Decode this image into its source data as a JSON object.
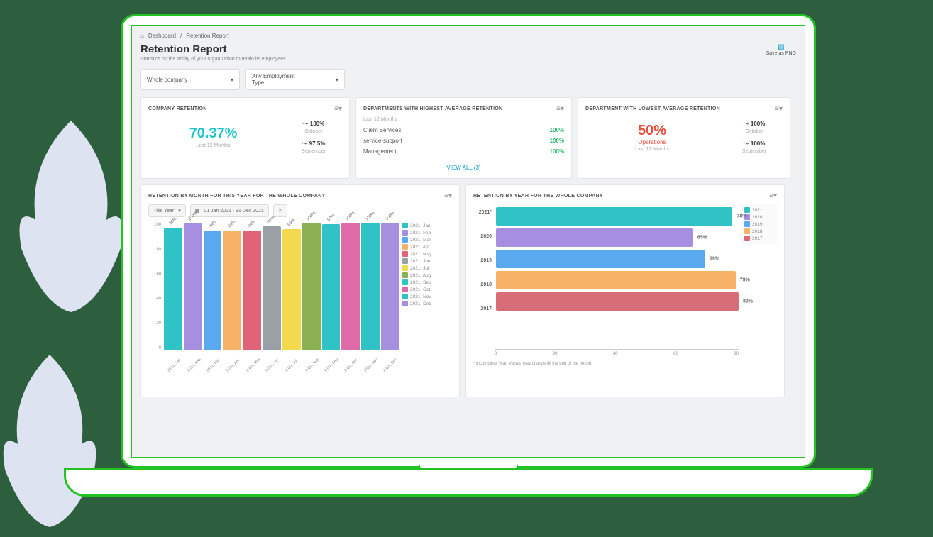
{
  "breadcrumb": {
    "home": "Dashboard",
    "current": "Retention Report"
  },
  "page": {
    "title": "Retention Report",
    "subtitle": "Statistics on the ability of your organization to retain its employees.",
    "save": "Save as PNG"
  },
  "filters": {
    "scope": "Whole company",
    "emp_type": "Any Employment Type"
  },
  "card_retention": {
    "title": "COMPANY RETENTION",
    "value": "70.37%",
    "period": "Last 12 Months",
    "m1": {
      "val": "100%",
      "lbl": "October"
    },
    "m2": {
      "val": "97.5%",
      "lbl": "September"
    }
  },
  "card_highest": {
    "title": "DEPARTMENTS WITH HIGHEST AVERAGE RETENTION",
    "period": "Last 12 Months",
    "rows": [
      {
        "name": "Client Services",
        "val": "100%"
      },
      {
        "name": "service-support",
        "val": "100%"
      },
      {
        "name": "Management",
        "val": "100%"
      }
    ],
    "view_all": "VIEW ALL (3)"
  },
  "card_lowest": {
    "title": "DEPARTMENT WITH LOWEST AVERAGE RETENTION",
    "value": "50%",
    "dept": "Operations",
    "period": "Last 12 Months",
    "m1": {
      "val": "100%",
      "lbl": "October"
    },
    "m2": {
      "val": "100%",
      "lbl": "September"
    }
  },
  "card_month": {
    "title": "RETENTION BY MONTH FOR THIS YEAR FOR THE WHOLE COMPANY",
    "range_select": "This Year",
    "date_range": "01 Jan 2021 - 31 Dec 2021"
  },
  "card_year": {
    "title": "RETENTION BY YEAR FOR THE WHOLE COMPANY",
    "note": "* Incomplete Year. Values may change till the end of the period."
  },
  "chart_data": [
    {
      "type": "bar",
      "title": "Retention by Month",
      "categories": [
        "2021, Jan",
        "2021, Feb",
        "2021, Mar",
        "2021, Apr",
        "2021, May",
        "2021, Jun",
        "2021, Jul",
        "2021, Aug",
        "2021, Sep",
        "2021, Oct",
        "2021, Nov",
        "2021, Dec"
      ],
      "values": [
        96,
        100,
        94,
        94,
        94,
        97,
        95,
        100,
        99,
        100,
        100,
        100
      ],
      "colors": [
        "#2fc3c8",
        "#a68fe0",
        "#5aa8ed",
        "#f7b267",
        "#e06377",
        "#9aa0a6",
        "#f2d94e",
        "#8bb153",
        "#2fc3c8",
        "#e06ba8",
        "#2fc3c8",
        "#a68fe0"
      ],
      "ylim": [
        0,
        100
      ],
      "yticks": [
        0,
        20,
        40,
        60,
        80,
        100
      ]
    },
    {
      "type": "bar",
      "orientation": "horizontal",
      "title": "Retention by Year",
      "categories": [
        "2021*",
        "2020",
        "2019",
        "2018",
        "2017"
      ],
      "values": [
        78,
        65,
        69,
        79,
        80
      ],
      "colors": [
        "#2fc3c8",
        "#a68fe0",
        "#5aa8ed",
        "#f7b267",
        "#d76d77"
      ],
      "xlim": [
        0,
        80
      ],
      "xticks": [
        0,
        20,
        40,
        60,
        80
      ],
      "legend": [
        "2021",
        "2020",
        "2019",
        "2018",
        "2017"
      ]
    }
  ]
}
